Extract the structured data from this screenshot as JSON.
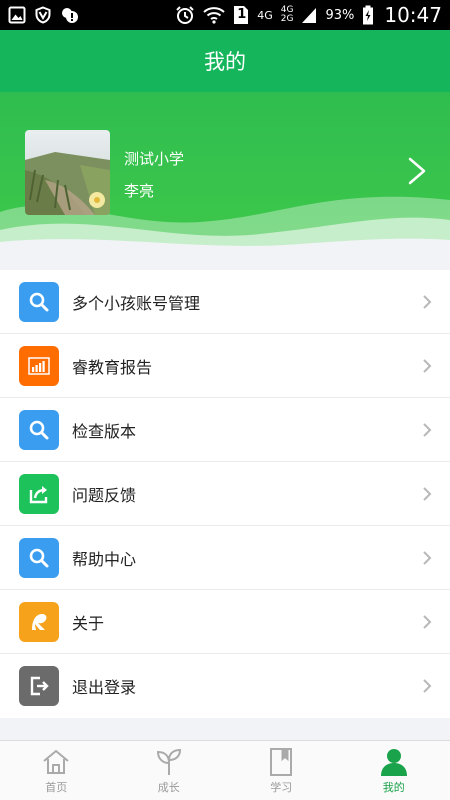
{
  "status_bar": {
    "network_4g": "4G",
    "network_4g_2g_top": "4G",
    "network_4g_2g_bottom": "2G",
    "sim_number": "1",
    "battery": "93%",
    "time": "10:47"
  },
  "header": {
    "title": "我的"
  },
  "profile": {
    "school": "测试小学",
    "name": "李亮"
  },
  "menu": [
    {
      "label": "多个小孩账号管理",
      "icon": "search-icon",
      "color": "#3a9df0"
    },
    {
      "label": "睿教育报告",
      "icon": "bar-chart-icon",
      "color": "#ff6d00"
    },
    {
      "label": "检查版本",
      "icon": "search-icon",
      "color": "#3a9df0"
    },
    {
      "label": "问题反馈",
      "icon": "share-icon",
      "color": "#1ec25a"
    },
    {
      "label": "帮助中心",
      "icon": "search-icon",
      "color": "#3a9df0"
    },
    {
      "label": "关于",
      "icon": "logo-r-icon",
      "color": "#f7a21b"
    },
    {
      "label": "退出登录",
      "icon": "logout-icon",
      "color": "#6b6b6b"
    }
  ],
  "bottom_nav": [
    {
      "label": "首页",
      "icon": "home-icon",
      "active": false
    },
    {
      "label": "成长",
      "icon": "sprout-icon",
      "active": false
    },
    {
      "label": "学习",
      "icon": "book-icon",
      "active": false
    },
    {
      "label": "我的",
      "icon": "person-icon",
      "active": true
    }
  ],
  "colors": {
    "primary": "#15b65b",
    "active_tab": "#1aa34a",
    "inactive_tab": "#9a9a9a"
  }
}
